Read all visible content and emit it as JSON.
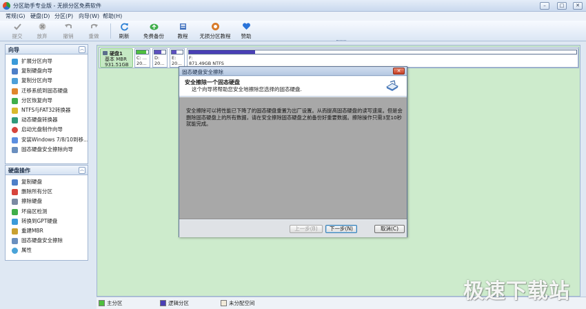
{
  "window": {
    "title": "分区助手专业版 - 无损分区免费软件",
    "btn_minimize": "–",
    "btn_maximize": "□",
    "btn_close": "✕"
  },
  "menu": [
    "常规(G)",
    "硬盘(D)",
    "分区(P)",
    "向导(W)",
    "帮助(H)"
  ],
  "toolbar": [
    {
      "label": "提交",
      "icon": "check-icon",
      "disabled": true
    },
    {
      "label": "放弃",
      "icon": "discard-icon",
      "disabled": true
    },
    {
      "label": "撤销",
      "icon": "undo-icon",
      "disabled": true
    },
    {
      "label": "重做",
      "icon": "redo-icon",
      "disabled": true
    },
    {
      "label": "刷新",
      "icon": "refresh-icon",
      "disabled": false
    },
    {
      "label": "免费备份",
      "icon": "backup-icon",
      "disabled": false
    },
    {
      "label": "教程",
      "icon": "tutorial-icon",
      "disabled": false
    },
    {
      "label": "无损分区教程",
      "icon": "partition-tutorial-icon",
      "disabled": false
    },
    {
      "label": "赞助",
      "icon": "heart-icon",
      "disabled": false
    }
  ],
  "wizard_panel": {
    "title": "向导",
    "items": [
      "扩展分区向导",
      "复制硬盘向导",
      "复制分区向导",
      "迁移系统到固态硬盘",
      "分区恢复向导",
      "NTFS与FAT32转换器",
      "动态硬盘转换器",
      "启动光盘制作向导",
      "安装Windows 7/8/10到移...",
      "固态硬盘安全擦除向导"
    ]
  },
  "disk_panel": {
    "title": "硬盘操作",
    "items": [
      "复制硬盘",
      "删除所有分区",
      "擦除硬盘",
      "坏扇区检测",
      "转换到GPT硬盘",
      "重建MBR",
      "固态硬盘安全擦除",
      "属性"
    ]
  },
  "disk": {
    "name": "硬盘1",
    "type": "基本 MBR",
    "size": "931.51GB",
    "partitions": [
      {
        "letter": "C: ...",
        "size": "20...",
        "color": "#4fbf3e",
        "fill": 0.85
      },
      {
        "letter": "D:",
        "size": "20...",
        "color": "#5d4fbf",
        "fill": 0.6
      },
      {
        "letter": "E:",
        "size": "20...",
        "color": "#5d4fbf",
        "fill": 0.45
      },
      {
        "letter": "F:",
        "size": "871.49GB NTFS",
        "color": "#4a3fb5",
        "fill": 0.17
      }
    ]
  },
  "dialog": {
    "title": "固态硬盘安全擦除",
    "close": "✕",
    "header_title": "安全擦除一个固态硬盘",
    "header_subtitle": "这个向导将帮助您安全地擦除您选择的固态硬盘.",
    "body": "安全擦除可以将性能已下降了的固态硬盘重置为出厂设置。从而提高固态硬盘的读写速度。但是会删除固态硬盘上的所有数据，请在安全擦除固态硬盘之前备份好重要数据。擦除操作只需3至10秒就能完成。",
    "btn_back": "上一步(B)",
    "btn_next": "下一步(N)",
    "btn_cancel": "取消(C)"
  },
  "legend": [
    {
      "label": "主分区",
      "color": "#4fbf3e"
    },
    {
      "label": "逻辑分区",
      "color": "#4a3fb5"
    },
    {
      "label": "未分配空间",
      "color": "#f2ead9"
    }
  ],
  "watermark": "极速下载站"
}
